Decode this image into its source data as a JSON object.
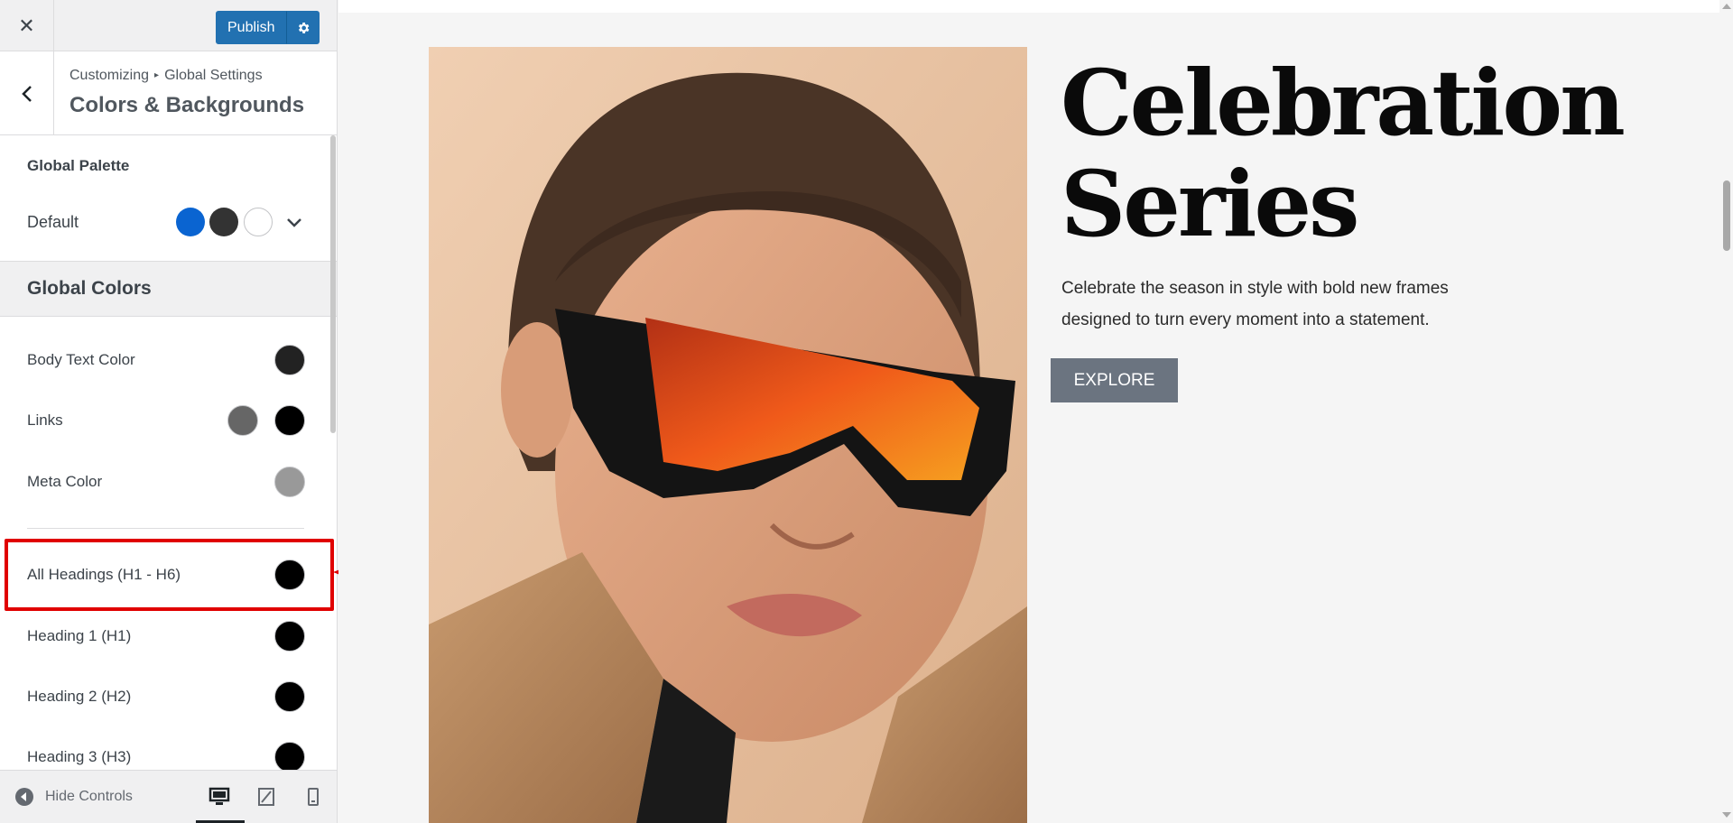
{
  "topbar": {
    "close_icon": "close-icon",
    "publish_label": "Publish",
    "settings_icon": "gear-icon"
  },
  "section": {
    "breadcrumb_root": "Customizing",
    "breadcrumb_sep": "▸",
    "breadcrumb_parent": "Global Settings",
    "title": "Colors & Backgrounds"
  },
  "palette": {
    "label": "Global Palette",
    "selected": "Default",
    "swatches": [
      "#0a64d1",
      "#333333",
      "#ffffff"
    ]
  },
  "global_colors": {
    "title": "Global Colors",
    "rows": [
      {
        "label": "Body Text Color",
        "colors": [
          "#222222"
        ]
      },
      {
        "label": "Links",
        "colors": [
          "#666666",
          "#000000"
        ]
      },
      {
        "label": "Meta Color",
        "colors": [
          "#999999"
        ]
      },
      {
        "label": "All Headings (H1 - H6)",
        "colors": [
          "#000000"
        ],
        "highlighted": true
      },
      {
        "label": "Heading 1 (H1)",
        "colors": [
          "#000000"
        ]
      },
      {
        "label": "Heading 2 (H2)",
        "colors": [
          "#000000"
        ]
      },
      {
        "label": "Heading 3 (H3)",
        "colors": [
          "#000000"
        ]
      }
    ]
  },
  "footer": {
    "hide_controls_label": "Hide Controls",
    "devices": [
      "desktop-icon",
      "tablet-icon",
      "mobile-icon"
    ],
    "active_device": "desktop"
  },
  "preview": {
    "heading_line1": "Celebration",
    "heading_line2": "Series",
    "text_line1": "Celebrate the season in style with bold new frames",
    "text_line2": "designed to turn every moment into a statement.",
    "button_label": "EXPLORE",
    "button_color": "#6b7480"
  },
  "annotation": {
    "highlight_color": "#e00000"
  }
}
